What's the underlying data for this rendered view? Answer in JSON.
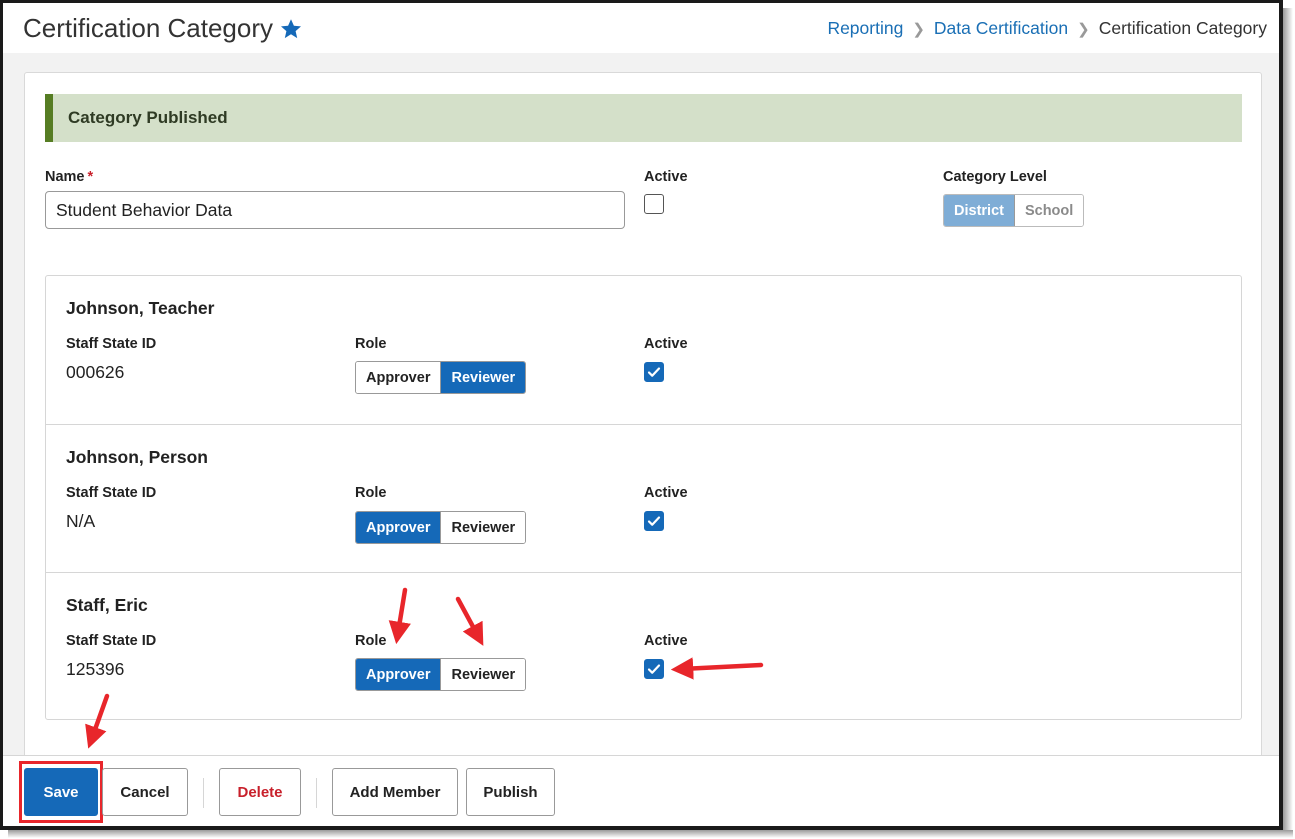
{
  "page": {
    "title": "Certification Category",
    "breadcrumb": [
      "Reporting",
      "Data Certification",
      "Certification Category"
    ]
  },
  "banner": {
    "text": "Category Published"
  },
  "form": {
    "name_label": "Name",
    "required_mark": "*",
    "name_value": "Student Behavior Data",
    "active_label": "Active",
    "active_checked": false,
    "category_level_label": "Category Level",
    "category_level_options": [
      "District",
      "School"
    ],
    "category_level_selected": "District"
  },
  "members_labels": {
    "staff_state_id": "Staff State ID",
    "role": "Role",
    "active": "Active",
    "role_options": [
      "Approver",
      "Reviewer"
    ]
  },
  "members": [
    {
      "name": "Johnson, Teacher",
      "staff_state_id": "000626",
      "role": "Reviewer",
      "active": true
    },
    {
      "name": "Johnson, Person",
      "staff_state_id": "N/A",
      "role": "Approver",
      "active": true
    },
    {
      "name": "Staff, Eric",
      "staff_state_id": "125396",
      "role": "Approver",
      "active": true
    }
  ],
  "footer": {
    "save": "Save",
    "cancel": "Cancel",
    "delete": "Delete",
    "add_member": "Add Member",
    "publish": "Publish"
  },
  "colors": {
    "primary": "#1569b8",
    "banner_bg": "#d4e0c9",
    "banner_accent": "#567d23",
    "annotation": "#e8262b",
    "danger": "#c8202b"
  }
}
